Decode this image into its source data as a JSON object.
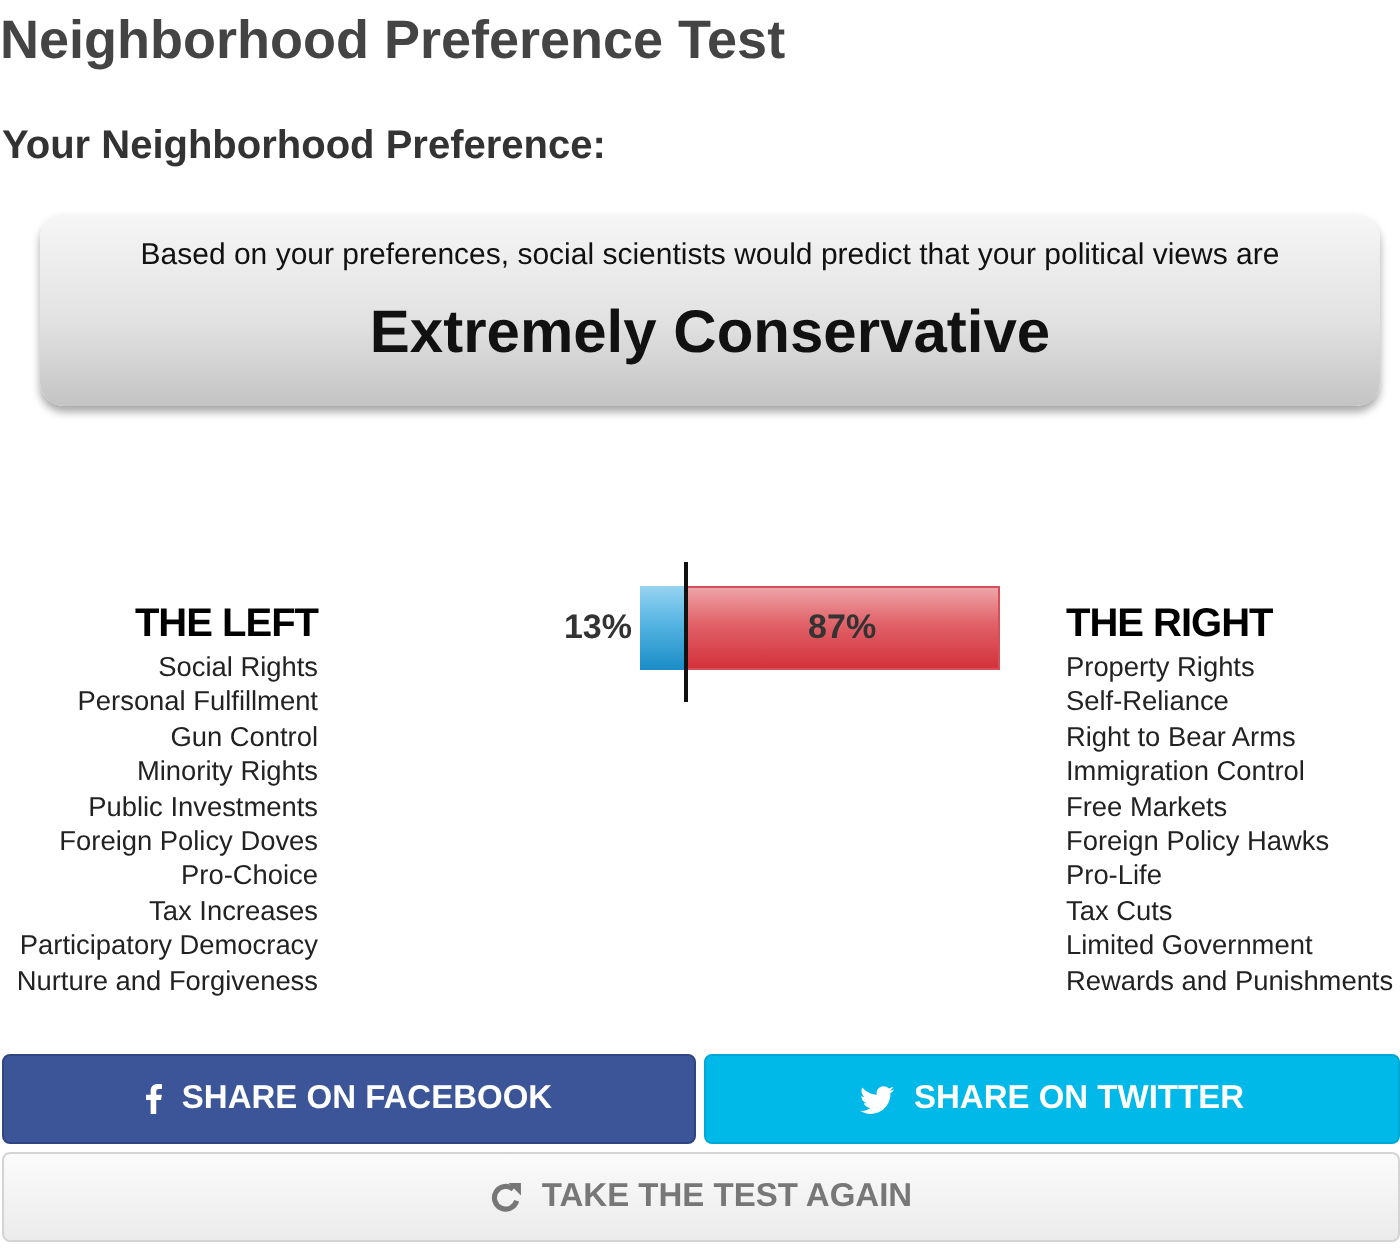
{
  "title": "Neighborhood Preference Test",
  "subtitle": "Your Neighborhood Preference:",
  "result_card": {
    "intro": "Based on your preferences, social scientists would predict that your political views are",
    "verdict": "Extremely Conservative"
  },
  "meter": {
    "level": 0.13,
    "left_reading": "13%",
    "right_reading": "87%"
  },
  "left_column": {
    "heading": "THE LEFT",
    "items": [
      "Social Rights",
      "Personal Fulfillment",
      "Gun Control",
      "Minority Rights",
      "Public Investments",
      "Foreign Policy Doves",
      "Pro-Choice",
      "Tax Increases",
      "Participatory Democracy",
      "Nurture and Forgiveness"
    ]
  },
  "right_column": {
    "heading": "THE RIGHT",
    "items": [
      "Property Rights",
      "Self-Reliance",
      "Right to Bear Arms",
      "Immigration Control",
      "Free Markets",
      "Foreign Policy Hawks",
      "Pro-Life",
      "Tax Cuts",
      "Limited Government",
      "Rewards and Punishments"
    ]
  },
  "buttons": [
    {
      "kind": "facebook",
      "label": "SHARE ON FACEBOOK"
    },
    {
      "kind": "twitter",
      "label": "SHARE ON TWITTER"
    },
    {
      "kind": "retake",
      "label": "TAKE THE TEST AGAIN"
    }
  ]
}
